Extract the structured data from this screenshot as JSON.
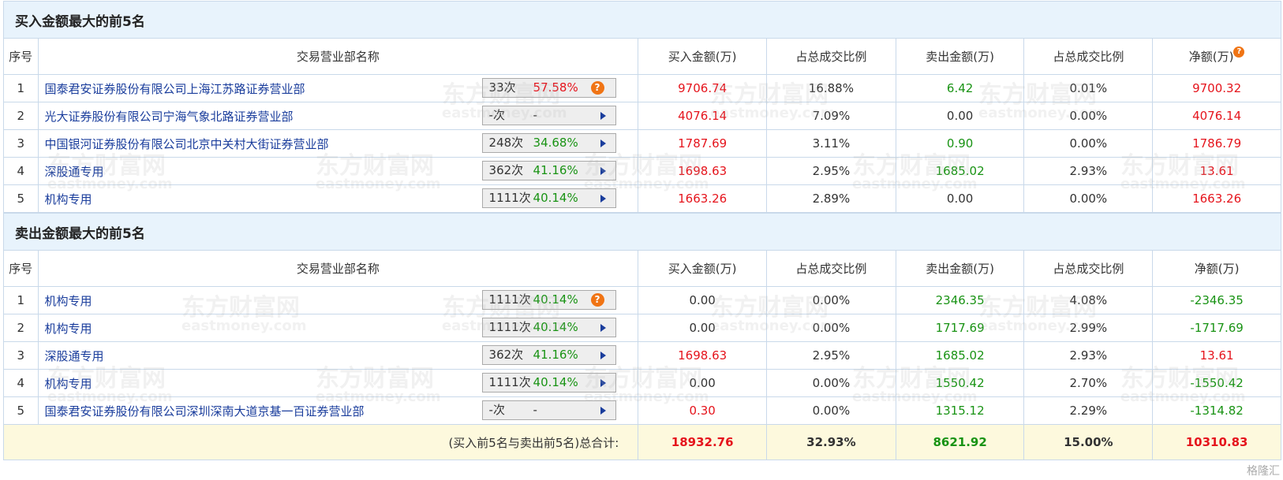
{
  "buy": {
    "title": "买入金额最大的前5名",
    "rows": [
      {
        "no": "1",
        "name": "国泰君安证券股份有限公司上海江苏路证券营业部",
        "count": "33次",
        "pct": "57.58%",
        "pct_color": "red",
        "action": "help",
        "buy": "9706.74",
        "buy_color": "red",
        "buy_ratio": "16.88%",
        "sell": "6.42",
        "sell_color": "green",
        "sell_ratio": "0.01%",
        "net": "9700.32",
        "net_color": "red"
      },
      {
        "no": "2",
        "name": "光大证券股份有限公司宁海气象北路证券营业部",
        "count": "-次",
        "pct": "-",
        "pct_color": "plain",
        "action": "arrow",
        "buy": "4076.14",
        "buy_color": "red",
        "buy_ratio": "7.09%",
        "sell": "0.00",
        "sell_color": "plain",
        "sell_ratio": "0.00%",
        "net": "4076.14",
        "net_color": "red"
      },
      {
        "no": "3",
        "name": "中国银河证券股份有限公司北京中关村大街证券营业部",
        "count": "248次",
        "pct": "34.68%",
        "pct_color": "green",
        "action": "arrow",
        "buy": "1787.69",
        "buy_color": "red",
        "buy_ratio": "3.11%",
        "sell": "0.90",
        "sell_color": "green",
        "sell_ratio": "0.00%",
        "net": "1786.79",
        "net_color": "red"
      },
      {
        "no": "4",
        "name": "深股通专用",
        "count": "362次",
        "pct": "41.16%",
        "pct_color": "green",
        "action": "arrow",
        "buy": "1698.63",
        "buy_color": "red",
        "buy_ratio": "2.95%",
        "sell": "1685.02",
        "sell_color": "green",
        "sell_ratio": "2.93%",
        "net": "13.61",
        "net_color": "red"
      },
      {
        "no": "5",
        "name": "机构专用",
        "count": "1111次",
        "pct": "40.14%",
        "pct_color": "green",
        "action": "arrow",
        "buy": "1663.26",
        "buy_color": "red",
        "buy_ratio": "2.89%",
        "sell": "0.00",
        "sell_color": "plain",
        "sell_ratio": "0.00%",
        "net": "1663.26",
        "net_color": "red"
      }
    ]
  },
  "sell": {
    "title": "卖出金额最大的前5名",
    "rows": [
      {
        "no": "1",
        "name": "机构专用",
        "count": "1111次",
        "pct": "40.14%",
        "pct_color": "green",
        "action": "help",
        "buy": "0.00",
        "buy_color": "plain",
        "buy_ratio": "0.00%",
        "sell": "2346.35",
        "sell_color": "green",
        "sell_ratio": "4.08%",
        "net": "-2346.35",
        "net_color": "green"
      },
      {
        "no": "2",
        "name": "机构专用",
        "count": "1111次",
        "pct": "40.14%",
        "pct_color": "green",
        "action": "arrow",
        "buy": "0.00",
        "buy_color": "plain",
        "buy_ratio": "0.00%",
        "sell": "1717.69",
        "sell_color": "green",
        "sell_ratio": "2.99%",
        "net": "-1717.69",
        "net_color": "green"
      },
      {
        "no": "3",
        "name": "深股通专用",
        "count": "362次",
        "pct": "41.16%",
        "pct_color": "green",
        "action": "arrow",
        "buy": "1698.63",
        "buy_color": "red",
        "buy_ratio": "2.95%",
        "sell": "1685.02",
        "sell_color": "green",
        "sell_ratio": "2.93%",
        "net": "13.61",
        "net_color": "red"
      },
      {
        "no": "4",
        "name": "机构专用",
        "count": "1111次",
        "pct": "40.14%",
        "pct_color": "green",
        "action": "arrow",
        "buy": "0.00",
        "buy_color": "plain",
        "buy_ratio": "0.00%",
        "sell": "1550.42",
        "sell_color": "green",
        "sell_ratio": "2.70%",
        "net": "-1550.42",
        "net_color": "green"
      },
      {
        "no": "5",
        "name": "国泰君安证券股份有限公司深圳深南大道京基一百证券营业部",
        "count": "-次",
        "pct": "-",
        "pct_color": "plain",
        "action": "arrow",
        "buy": "0.30",
        "buy_color": "red",
        "buy_ratio": "0.00%",
        "sell": "1315.12",
        "sell_color": "green",
        "sell_ratio": "2.29%",
        "net": "-1314.82",
        "net_color": "green"
      }
    ]
  },
  "headers": {
    "no": "序号",
    "name": "交易营业部名称",
    "buy": "买入金额(万)",
    "buy_ratio": "占总成交比例",
    "sell": "卖出金额(万)",
    "sell_ratio": "占总成交比例",
    "net": "净额(万)"
  },
  "help_glyph": "?",
  "total": {
    "label": "(买入前5名与卖出前5名)总合计:",
    "buy": "18932.76",
    "buy_ratio": "32.93%",
    "sell": "8621.92",
    "sell_ratio": "15.00%",
    "net": "10310.83"
  },
  "watermark": {
    "cn": "东方财富网",
    "en": "eastmoney.com"
  },
  "corner_mark": "格隆汇",
  "colors": {
    "red": "#e5141c",
    "green": "#199314",
    "link": "#1a3d9c",
    "section_bg": "#e8f3fc",
    "total_bg": "#fdf9dd",
    "border": "#c9d9ea"
  },
  "icons": {
    "help": "question-help-icon",
    "arrow": "play-arrow-icon"
  }
}
